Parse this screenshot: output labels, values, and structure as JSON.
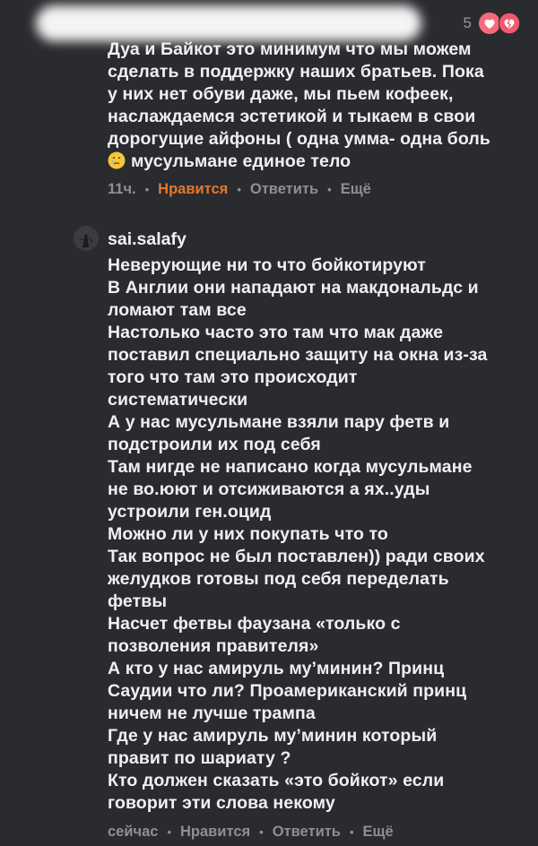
{
  "first_comment": {
    "like_count": "5",
    "lines": [
      "Дуа и Байкот это минимум что мы можем",
      "сделать в поддержку наших братьев. Пока",
      "у них нет обуви даже, мы пьем кофеек,",
      "наслаждаемся эстетикой и тыкаем в свои",
      "дорогущие айфоны ( одна умма- одна боль"
    ],
    "last_line_text": "мусульмане единое тело",
    "emoji": "crying-face",
    "time": "11ч.",
    "like_label": "Нравится",
    "reply_label": "Ответить",
    "more_label": "Ещё",
    "liked_color": "#e8762c"
  },
  "second_comment": {
    "username": "sai.salafy",
    "lines": [
      "Неверующие ни то что бойкотируют",
      "В Англии они нападают на макдональдс и",
      "ломают там все",
      "Настолько часто это там что мак даже",
      "поставил специально защиту на окна из-за",
      "того что там это происходит",
      "систематически",
      "А у нас мусульмане взяли пару фетв и",
      "подстроили их под себя",
      "Там нигде не написано когда мусульмане",
      "не во.юют и отсиживаются а ях..уды",
      "устроили ген.оцид",
      "Можно ли у них покупать что то",
      "Так вопрос не был поставлен)) ради своих",
      "желудков готовы под себя переделать",
      "фетвы",
      "Насчет фетвы фаузана «только с",
      "позволения правителя»",
      "А кто у нас амируль му’минин? Принц",
      "Саудии что ли? Проамериканский принц",
      "ничем не лучше трампа",
      "Где у нас амируль му’минин который",
      "правит по шариату ?",
      "Кто должен сказать «это бойкот» если",
      "говорит эти слова некому"
    ],
    "time": "сейчас",
    "like_label": "Нравится",
    "reply_label": "Ответить",
    "more_label": "Ещё"
  }
}
